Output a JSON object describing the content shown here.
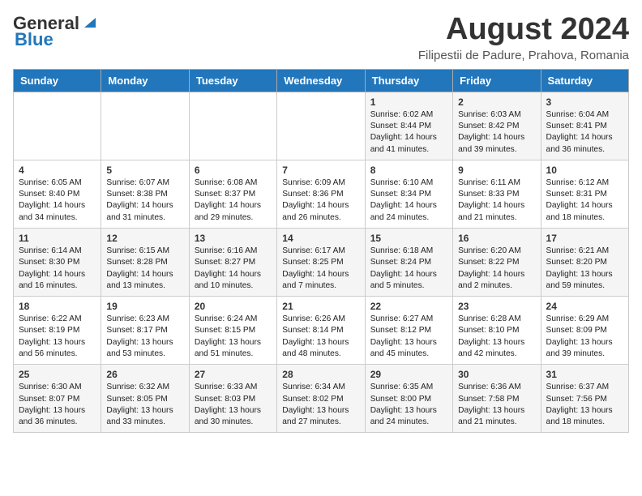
{
  "header": {
    "logo_line1": "General",
    "logo_line2": "Blue",
    "main_title": "August 2024",
    "subtitle": "Filipestii de Padure, Prahova, Romania"
  },
  "calendar": {
    "days_of_week": [
      "Sunday",
      "Monday",
      "Tuesday",
      "Wednesday",
      "Thursday",
      "Friday",
      "Saturday"
    ],
    "weeks": [
      [
        {
          "day": "",
          "detail": ""
        },
        {
          "day": "",
          "detail": ""
        },
        {
          "day": "",
          "detail": ""
        },
        {
          "day": "",
          "detail": ""
        },
        {
          "day": "1",
          "detail": "Sunrise: 6:02 AM\nSunset: 8:44 PM\nDaylight: 14 hours\nand 41 minutes."
        },
        {
          "day": "2",
          "detail": "Sunrise: 6:03 AM\nSunset: 8:42 PM\nDaylight: 14 hours\nand 39 minutes."
        },
        {
          "day": "3",
          "detail": "Sunrise: 6:04 AM\nSunset: 8:41 PM\nDaylight: 14 hours\nand 36 minutes."
        }
      ],
      [
        {
          "day": "4",
          "detail": "Sunrise: 6:05 AM\nSunset: 8:40 PM\nDaylight: 14 hours\nand 34 minutes."
        },
        {
          "day": "5",
          "detail": "Sunrise: 6:07 AM\nSunset: 8:38 PM\nDaylight: 14 hours\nand 31 minutes."
        },
        {
          "day": "6",
          "detail": "Sunrise: 6:08 AM\nSunset: 8:37 PM\nDaylight: 14 hours\nand 29 minutes."
        },
        {
          "day": "7",
          "detail": "Sunrise: 6:09 AM\nSunset: 8:36 PM\nDaylight: 14 hours\nand 26 minutes."
        },
        {
          "day": "8",
          "detail": "Sunrise: 6:10 AM\nSunset: 8:34 PM\nDaylight: 14 hours\nand 24 minutes."
        },
        {
          "day": "9",
          "detail": "Sunrise: 6:11 AM\nSunset: 8:33 PM\nDaylight: 14 hours\nand 21 minutes."
        },
        {
          "day": "10",
          "detail": "Sunrise: 6:12 AM\nSunset: 8:31 PM\nDaylight: 14 hours\nand 18 minutes."
        }
      ],
      [
        {
          "day": "11",
          "detail": "Sunrise: 6:14 AM\nSunset: 8:30 PM\nDaylight: 14 hours\nand 16 minutes."
        },
        {
          "day": "12",
          "detail": "Sunrise: 6:15 AM\nSunset: 8:28 PM\nDaylight: 14 hours\nand 13 minutes."
        },
        {
          "day": "13",
          "detail": "Sunrise: 6:16 AM\nSunset: 8:27 PM\nDaylight: 14 hours\nand 10 minutes."
        },
        {
          "day": "14",
          "detail": "Sunrise: 6:17 AM\nSunset: 8:25 PM\nDaylight: 14 hours\nand 7 minutes."
        },
        {
          "day": "15",
          "detail": "Sunrise: 6:18 AM\nSunset: 8:24 PM\nDaylight: 14 hours\nand 5 minutes."
        },
        {
          "day": "16",
          "detail": "Sunrise: 6:20 AM\nSunset: 8:22 PM\nDaylight: 14 hours\nand 2 minutes."
        },
        {
          "day": "17",
          "detail": "Sunrise: 6:21 AM\nSunset: 8:20 PM\nDaylight: 13 hours\nand 59 minutes."
        }
      ],
      [
        {
          "day": "18",
          "detail": "Sunrise: 6:22 AM\nSunset: 8:19 PM\nDaylight: 13 hours\nand 56 minutes."
        },
        {
          "day": "19",
          "detail": "Sunrise: 6:23 AM\nSunset: 8:17 PM\nDaylight: 13 hours\nand 53 minutes."
        },
        {
          "day": "20",
          "detail": "Sunrise: 6:24 AM\nSunset: 8:15 PM\nDaylight: 13 hours\nand 51 minutes."
        },
        {
          "day": "21",
          "detail": "Sunrise: 6:26 AM\nSunset: 8:14 PM\nDaylight: 13 hours\nand 48 minutes."
        },
        {
          "day": "22",
          "detail": "Sunrise: 6:27 AM\nSunset: 8:12 PM\nDaylight: 13 hours\nand 45 minutes."
        },
        {
          "day": "23",
          "detail": "Sunrise: 6:28 AM\nSunset: 8:10 PM\nDaylight: 13 hours\nand 42 minutes."
        },
        {
          "day": "24",
          "detail": "Sunrise: 6:29 AM\nSunset: 8:09 PM\nDaylight: 13 hours\nand 39 minutes."
        }
      ],
      [
        {
          "day": "25",
          "detail": "Sunrise: 6:30 AM\nSunset: 8:07 PM\nDaylight: 13 hours\nand 36 minutes."
        },
        {
          "day": "26",
          "detail": "Sunrise: 6:32 AM\nSunset: 8:05 PM\nDaylight: 13 hours\nand 33 minutes."
        },
        {
          "day": "27",
          "detail": "Sunrise: 6:33 AM\nSunset: 8:03 PM\nDaylight: 13 hours\nand 30 minutes."
        },
        {
          "day": "28",
          "detail": "Sunrise: 6:34 AM\nSunset: 8:02 PM\nDaylight: 13 hours\nand 27 minutes."
        },
        {
          "day": "29",
          "detail": "Sunrise: 6:35 AM\nSunset: 8:00 PM\nDaylight: 13 hours\nand 24 minutes."
        },
        {
          "day": "30",
          "detail": "Sunrise: 6:36 AM\nSunset: 7:58 PM\nDaylight: 13 hours\nand 21 minutes."
        },
        {
          "day": "31",
          "detail": "Sunrise: 6:37 AM\nSunset: 7:56 PM\nDaylight: 13 hours\nand 18 minutes."
        }
      ]
    ]
  }
}
